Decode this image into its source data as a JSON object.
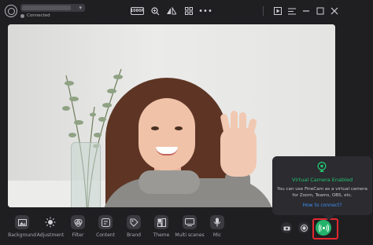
{
  "titlebar": {
    "status": "Connected",
    "resolution": "1080P",
    "icons": [
      "zoom-in-icon",
      "mirror-icon",
      "layout-grid-icon",
      "more-icon",
      "play-icon",
      "menu-icon",
      "minimize-icon",
      "maximize-icon",
      "close-icon"
    ]
  },
  "toolbar": {
    "items": [
      {
        "label": "Background",
        "icon": "image-icon"
      },
      {
        "label": "Adjustment",
        "icon": "sun-icon"
      },
      {
        "label": "Filter",
        "icon": "filter-icon"
      },
      {
        "label": "Content",
        "icon": "content-icon"
      },
      {
        "label": "Brand",
        "icon": "tag-icon"
      },
      {
        "label": "Theme",
        "icon": "theme-icon"
      },
      {
        "label": "Multi scenes",
        "icon": "scenes-icon"
      },
      {
        "label": "Mic",
        "icon": "mic-icon"
      }
    ]
  },
  "popup": {
    "title": "Virtual Camera Enabled",
    "description": "You can use FineCam as a virtual camera for Zoom, Teams, OBS, etc.",
    "link": "How to connect?"
  },
  "colors": {
    "accent_green": "#23b36a",
    "highlight_red": "#e3292f",
    "link_blue": "#3f8ff0"
  }
}
